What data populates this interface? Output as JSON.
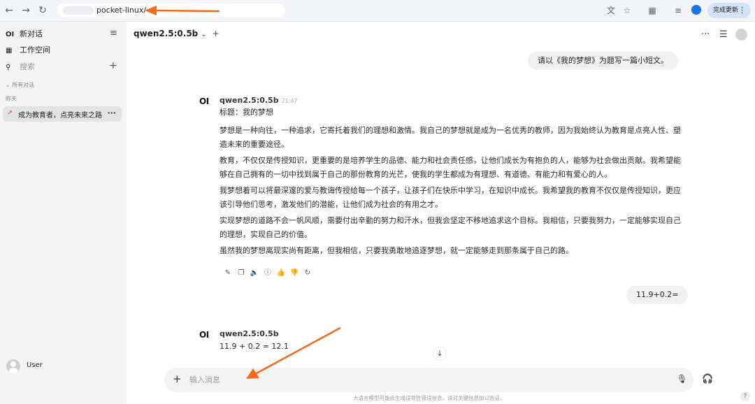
{
  "browser": {
    "url": "pocket-linux/",
    "update_label": "完成更新"
  },
  "sidebar": {
    "logo": "OI",
    "new_chat": "新对话",
    "workspace": "工作空间",
    "search_placeholder": "搜索",
    "all_chats": "所有对话",
    "section_yesterday": "昨天",
    "chat_title": "成为教育者，点亮未来之路",
    "user_name": "User"
  },
  "header": {
    "model": "qwen2.5:0.5b"
  },
  "messages": [
    {
      "role": "user",
      "text": "请以《我的梦想》为题写一篇小短文。"
    },
    {
      "role": "assistant",
      "name": "qwen2.5:0.5b",
      "time": "21:47",
      "title": "标题：我的梦想",
      "paragraphs": [
        "梦想是一种向往，一种追求，它寄托着我们的理想和激情。我自己的梦想就是成为一名优秀的教师，因为我始终认为教育是点亮人性、塑造未来的重要途径。",
        "教育，不仅仅是传授知识，更重要的是培养学生的品德、能力和社会责任感，让他们成长为有抱负的人，能够为社会做出贡献。我希望能够在自己拥有的一切中找到属于自己的那份教育的光芒，使我的学生都成为有理想、有道德、有能力和有爱心的人。",
        "我梦想着可以将最深邃的爱与教诲传授给每一个孩子，让孩子们在快乐中学习，在知识中成长。我希望我的教育不仅仅是传授知识，更应该引导他们思考，激发他们的潜能，让他们成为社会的有用之才。",
        "实现梦想的道路不会一帆风顺，需要付出辛勤的努力和汗水，但我会坚定不移地追求这个目标。我相信，只要我努力，一定能够实现自己的理想，实现自己的价值。",
        "虽然我的梦想离现实尚有距离，但我相信，只要我勇敢地追逐梦想，就一定能够走到那条属于自己的路。"
      ]
    },
    {
      "role": "user",
      "text": "11.9+0.2="
    },
    {
      "role": "assistant",
      "name": "qwen2.5:0.5b",
      "answer": "11.9 + 0.2 = 12.1"
    }
  ],
  "input": {
    "placeholder": "输入消息"
  },
  "disclaimer": "大语言模型可能会生成误导性错误信息，请对关键信息加以验证。",
  "help": "?",
  "colors": {
    "arrow": "#f26a1b",
    "sidebar_bg": "#f4f4f4",
    "bubble_bg": "#f1f1f1"
  }
}
